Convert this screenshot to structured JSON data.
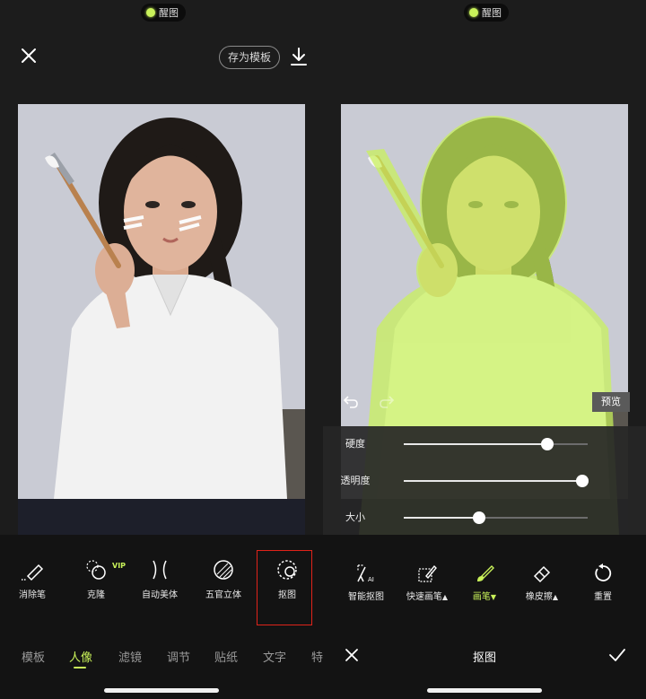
{
  "left": {
    "brand": "醒图",
    "save_template": "存为模板",
    "tools": [
      {
        "label": "消除笔",
        "icon": "eraser-pen-icon"
      },
      {
        "label": "克隆",
        "icon": "clone-icon",
        "badge": "VIP"
      },
      {
        "label": "自动美体",
        "icon": "auto-body-icon"
      },
      {
        "label": "五官立体",
        "icon": "face-contour-icon"
      },
      {
        "label": "抠图",
        "icon": "cutout-icon"
      }
    ],
    "tabs": [
      "模板",
      "人像",
      "滤镜",
      "调节",
      "贴纸",
      "文字",
      "特"
    ],
    "active_tab": "人像"
  },
  "right": {
    "brand": "醒图",
    "preview": "预览",
    "sliders": [
      {
        "label": "硬度",
        "value": 0.78
      },
      {
        "label": "透明度",
        "value": 0.97
      },
      {
        "label": "大小",
        "value": 0.41
      }
    ],
    "tools": [
      {
        "label": "智能抠图",
        "icon": "smart-cutout-icon",
        "caret": ""
      },
      {
        "label": "快速画笔",
        "icon": "quick-brush-icon",
        "caret": "▲"
      },
      {
        "label": "画笔",
        "icon": "brush-icon",
        "caret": "▼"
      },
      {
        "label": "橡皮擦",
        "icon": "eraser-icon",
        "caret": "▲"
      },
      {
        "label": "重置",
        "icon": "reset-icon",
        "caret": ""
      }
    ],
    "active_tool": "画笔",
    "title": "抠图"
  },
  "colors": {
    "accent": "#c9f25a",
    "overlay": "#c9f25a",
    "highlight_box": "#e0231a"
  }
}
